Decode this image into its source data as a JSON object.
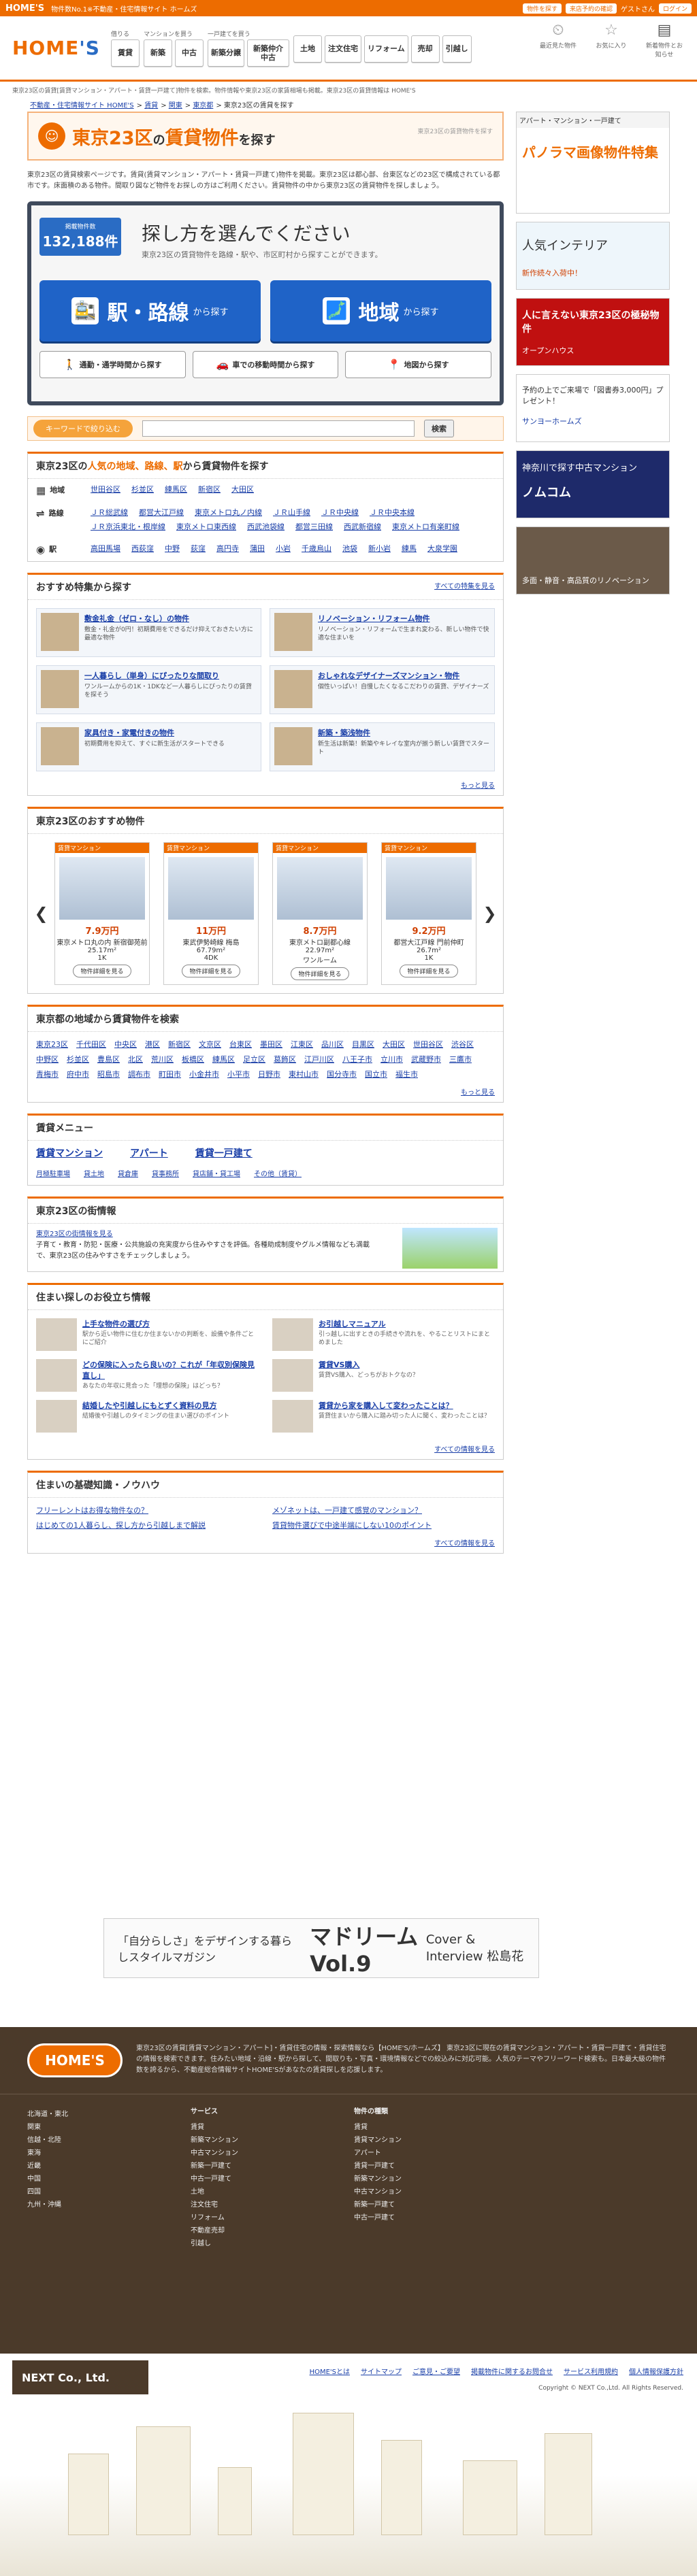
{
  "topbar": {
    "brand": "HOME'S",
    "tagline": "物件数No.1※不動産・住宅情報サイト ホームズ",
    "pills": [
      "物件を探す",
      "来店予約の確認",
      "ログイン"
    ],
    "guest": "ゲストさん"
  },
  "header": {
    "logo_main": "HOME",
    "logo_suffix": "'S",
    "groups": [
      {
        "caption": "借りる",
        "items": [
          "賃貸"
        ]
      },
      {
        "caption": "マンションを買う",
        "items": [
          "新築",
          "中古"
        ]
      },
      {
        "caption": "一戸建てを買う",
        "items": [
          "新築分譲",
          "新築仲介中古"
        ]
      },
      {
        "caption": "",
        "items": [
          "土地",
          "注文住宅",
          "リフォーム",
          "売却",
          "引越し"
        ]
      }
    ],
    "icons": [
      {
        "name": "history-icon",
        "glyph": "⏲",
        "label": "最近見た物件"
      },
      {
        "name": "star-icon",
        "glyph": "☆",
        "label": "お気に入り"
      },
      {
        "name": "news-icon",
        "glyph": "▤",
        "label": "新着物件とお知らせ"
      }
    ]
  },
  "notice": "東京23区の賃貸[賃貸マンション・アパート・賃貸一戸建て]物件を検索。物件情報や東京23区の家賃相場も掲載。東京23区の賃貸情報は HOME'S",
  "breadcrumb": [
    "不動産・住宅情報サイト HOME'S",
    "賃貸",
    "関東",
    "東京都",
    "東京23区の賃貸を探す"
  ],
  "title": {
    "main": "東京23区",
    "mid": "の",
    "sub": "賃貸物件",
    "suffix": "を探す",
    "right": "東京23区の賃貸物件を探す"
  },
  "intro": "東京23区の賃貸検索ページです。賃貸(賃貸マンション・アパート・賃貸一戸建て)物件を掲載。東京23区は都心部、台東区などの23区で構成されている都市です。床面積のある物件。間取り図など物件をお探しの方はご利用ください。賃貸物件の中から東京23区の賃貸物件を探しましょう。",
  "search": {
    "count_label": "掲載物件数",
    "count": "132,188件",
    "heading": "探し方を選んでください",
    "sub": "東京23区の賃貸物件を路線・駅や、市区町村から探すことができます。",
    "big": [
      {
        "name": "station-icon",
        "glyph": "🚉",
        "main": "駅・路線",
        "small": "から探す"
      },
      {
        "name": "area-icon",
        "glyph": "🗾",
        "main": "地域",
        "small": "から探す"
      }
    ],
    "small": [
      {
        "name": "commute-icon",
        "glyph": "🚶",
        "label": "通勤・通学時間から探す"
      },
      {
        "name": "car-icon",
        "glyph": "🚗",
        "label": "車での移動時間から探す"
      },
      {
        "name": "map-icon",
        "glyph": "📍",
        "label": "地図から探す"
      }
    ]
  },
  "keyword": {
    "label": "キーワードで絞り込む",
    "placeholder": "",
    "button": "検索"
  },
  "area_panel": {
    "title_pre": "東京23区の",
    "title_em": "人気の地域、路線、駅",
    "title_post": "から賃貸物件を探す",
    "rows": [
      {
        "name": "area-row",
        "icon": "▦",
        "key": "地域",
        "items": [
          "世田谷区",
          "杉並区",
          "練馬区",
          "新宿区",
          "大田区"
        ]
      },
      {
        "name": "line-row",
        "icon": "⇌",
        "key": "路線",
        "items": [
          "ＪＲ総武線",
          "都営大江戸線",
          "東京メトロ丸ノ内線",
          "ＪＲ山手線",
          "ＪＲ中央線",
          "ＪＲ中央本線",
          "ＪＲ京浜東北・根岸線",
          "東京メトロ東西線",
          "西武池袋線",
          "都営三田線",
          "西武新宿線",
          "東京メトロ有楽町線"
        ]
      },
      {
        "name": "station-row",
        "icon": "◉",
        "key": "駅",
        "items": [
          "高田馬場",
          "西荻窪",
          "中野",
          "荻窪",
          "高円寺",
          "蒲田",
          "小岩",
          "千歳烏山",
          "池袋",
          "新小岩",
          "練馬",
          "大泉学園"
        ]
      }
    ]
  },
  "features": {
    "title": "おすすめ特集から探す",
    "all_link": "すべての特集を見る",
    "more": "もっと見る",
    "items": [
      {
        "title": "敷金礼金（ゼロ・なし）の物件",
        "desc": "敷金・礼金が0円！初期費用をできるだけ抑えておきたい方に最適な物件"
      },
      {
        "title": "リノベーション・リフォーム物件",
        "desc": "リノベーション・リフォームで生まれ変わる、新しい物件で快適な住まいを"
      },
      {
        "title": "一人暮らし（単身）にぴったりな間取り",
        "desc": "ワンルームからの1K・1DKなど一人暮らしにぴったりの賃貸を探そう"
      },
      {
        "title": "おしゃれなデザイナーズマンション・物件",
        "desc": "個性いっぱい！自慢したくなるこだわりの賃貸、デザイナーズ"
      },
      {
        "title": "家具付き・家電付きの物件",
        "desc": "初期費用を抑えて、すぐに新生活がスタートできる"
      },
      {
        "title": "新築・築浅物件",
        "desc": "新生活は新築！新築やキレイな室内が揃う新しい賃貸でスタート"
      }
    ]
  },
  "reco": {
    "title": "東京23区のおすすめ物件",
    "tag": "賃貸マンション",
    "btn": "物件詳細を見る",
    "items": [
      {
        "price": "7.9万円",
        "station": "東京メトロ丸の内 新宿御苑前",
        "size": "25.17m²",
        "plan": "1K"
      },
      {
        "price": "11万円",
        "station": "東武伊勢崎線 梅島",
        "size": "67.79m²",
        "plan": "4DK"
      },
      {
        "price": "8.7万円",
        "station": "東京メトロ副都心線",
        "size": "22.97m²",
        "plan": "ワンルーム"
      },
      {
        "price": "9.2万円",
        "station": "都営大江戸線 門前仲町",
        "size": "26.7m²",
        "plan": "1K"
      }
    ]
  },
  "cities": {
    "title": "東京都の地域から賃貸物件を検索",
    "more": "もっと見る",
    "items": [
      "東京23区",
      "千代田区",
      "中央区",
      "港区",
      "新宿区",
      "文京区",
      "台東区",
      "墨田区",
      "江東区",
      "品川区",
      "目黒区",
      "大田区",
      "世田谷区",
      "渋谷区",
      "中野区",
      "杉並区",
      "豊島区",
      "北区",
      "荒川区",
      "板橋区",
      "練馬区",
      "足立区",
      "葛飾区",
      "江戸川区",
      "八王子市",
      "立川市",
      "武蔵野市",
      "三鷹市",
      "青梅市",
      "府中市",
      "昭島市",
      "調布市",
      "町田市",
      "小金井市",
      "小平市",
      "日野市",
      "東村山市",
      "国分寺市",
      "国立市",
      "福生市"
    ]
  },
  "menu": {
    "title": "賃貸メニュー",
    "main": [
      "賃貸マンション",
      "アパート",
      "賃貸一戸建て"
    ],
    "sub": [
      "月極駐車場",
      "貸土地",
      "貸倉庫",
      "貸事務所",
      "貸店舗・貸工場",
      "その他（賃貸）"
    ]
  },
  "info": {
    "title": "東京23区の街情報",
    "link": "東京23区の街情報を見る",
    "text": "子育て・教育・防犯・医療・公共施設の充実度から住みやすさを評価。各種助成制度やグルメ情報なども満載で、東京23区の住みやすさをチェックしましょう。"
  },
  "tips": {
    "title": "住まい探しのお役立ち情報",
    "all": "すべての情報を見る",
    "items": [
      {
        "t": "上手な物件の選び方",
        "d": "駅から近い物件に住むか住まないかの判断を、設備や条件ごとにご紹介"
      },
      {
        "t": "お引越しマニュアル",
        "d": "引っ越しに出すときの手続きや流れを、やることリストにまとめました"
      },
      {
        "t": "どの保険に入ったら良いの？これが「年収別保険見直し」",
        "d": "あなたの年収に見合った「理想の保険」はどっち？"
      },
      {
        "t": "賃貸VS購入",
        "d": "賃貸VS購入、どっちがおトクなの？"
      },
      {
        "t": "結婚したや引越しにもとずく資料の見方",
        "d": "結婚後や引越しのタイミングの住まい選びのポイント"
      },
      {
        "t": "賃貸から家を購入して変わったことは？",
        "d": "賃貸住まいから購入に踏み切った人に聞く、変わったことは？"
      }
    ]
  },
  "basics": {
    "title": "住まいの基礎知識・ノウハウ",
    "all": "すべての情報を見る",
    "items": [
      "フリーレントはお得な物件なの？",
      "メゾネットは、一戸建て感覚のマンション？",
      "はじめての1人暮らし、探し方から引越しまで解説",
      "賃貸物件選びで中途半端にしない10のポイント"
    ]
  },
  "banner": {
    "a": "「自分らしさ」をデザインする暮らしスタイルマガジン",
    "b": "マドリーム Vol.9",
    "c": "Cover & Interview 松島花"
  },
  "side": [
    {
      "h": "アパート・マンション・一戸建て",
      "b": "パノラマ画像物件特集"
    },
    {
      "h": "人気インテリア",
      "b": "新作続々入荷中！"
    },
    {
      "h": "人に言えない東京23区の極秘物件",
      "b": "オープンハウス"
    },
    {
      "h": "予約の上でご来場で「図書券3,000円」プレゼント！",
      "b": "サンヨーホームズ"
    },
    {
      "h": "神奈川で探す中古マンション",
      "b": "ノムコム"
    },
    {
      "h": "",
      "b": "多面・静音・高品質のリノベーション"
    }
  ],
  "footer": {
    "logo": "HOME'S",
    "desc": "東京23区の賃貸[賃貸マンション・アパート]・賃貸住宅の情報・探索情報なら【HOME'S/ホームズ】 東京23区に現在の賃貸マンション・アパート・賃貸一戸建て・賃貸住宅の情報を検索できます。住みたい地域・沿線・駅から探して、間取りも・写真・環境情報などでの絞込みに対応可能。人気のテーマやフリーワード検索も。日本最大級の物件数を誇るから、不動産総合情報サイトHOME'Sがあなたの賃貸探しを応援します。",
    "col1_cap": "",
    "col1": [
      "北海道・東北",
      "関東",
      "信越・北陸",
      "東海",
      "近畿",
      "中国",
      "四国",
      "九州・沖縄"
    ],
    "col2_cap": "サービス",
    "col2": [
      "賃貸",
      "新築マンション",
      "中古マンション",
      "新築一戸建て",
      "中古一戸建て",
      "土地",
      "注文住宅",
      "リフォーム",
      "不動産売却",
      "引越し"
    ],
    "col3_cap": "物件の種類",
    "col3": [
      "賃貸",
      "賃貸マンション",
      "アパート",
      "賃貸一戸建て",
      "新築マンション",
      "中古マンション",
      "新築一戸建て",
      "中古一戸建て"
    ],
    "company": "NEXT Co., Ltd.",
    "links": [
      "HOME'Sとは",
      "サイトマップ",
      "ご意見・ご要望",
      "掲載物件に関するお問合せ",
      "サービス利用規約",
      "個人情報保護方針"
    ],
    "copy": "Copyright © NEXT Co.,Ltd. All Rights Reserved."
  }
}
